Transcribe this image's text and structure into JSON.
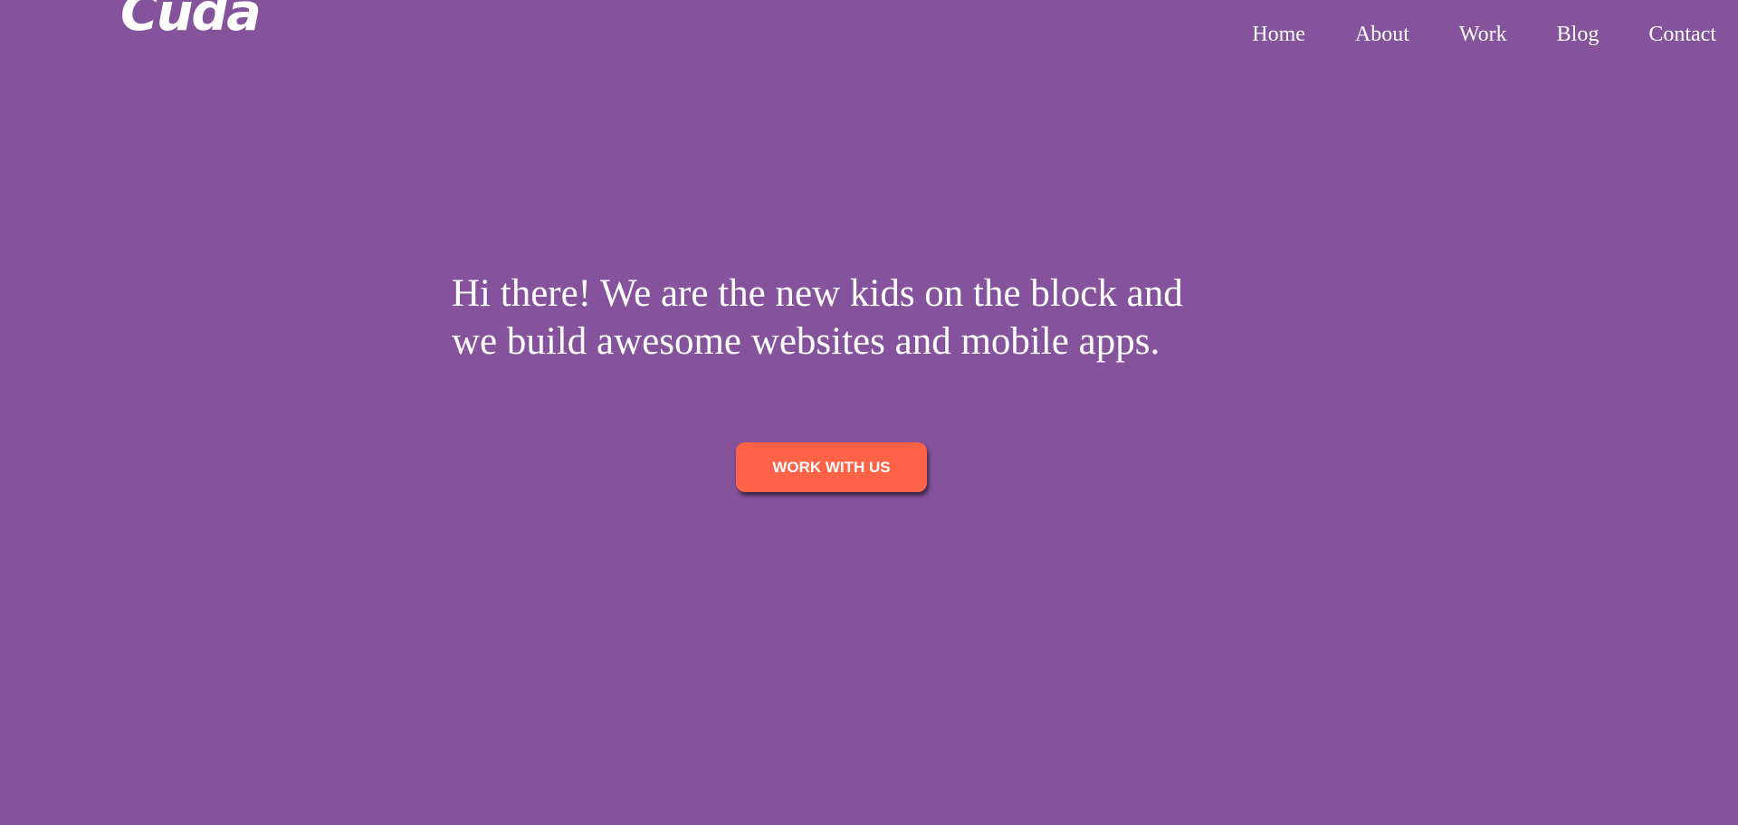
{
  "header": {
    "logo_text": "Cuda",
    "nav": [
      "Home",
      "About",
      "Work",
      "Blog",
      "Contact"
    ]
  },
  "hero": {
    "line1": "Hi there! We are the new kids on the block and",
    "line2": "we build awesome websites and mobile apps.",
    "cta_label": "WORK WITH US"
  },
  "colors": {
    "background": "#85529c",
    "cta": "#ff6347",
    "text": "#ffffff"
  }
}
